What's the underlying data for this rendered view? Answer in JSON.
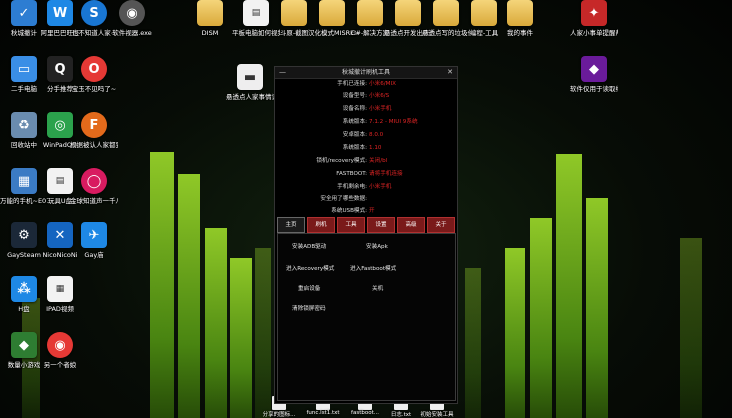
{
  "desktop": {
    "icons": [
      {
        "id": "i1",
        "label": "秋城撤计",
        "color": "#2d7dd2",
        "glyph": "✓"
      },
      {
        "id": "i2",
        "label": "阿里巴巴旺旺",
        "color": "#1e88e5",
        "glyph": "W"
      },
      {
        "id": "i3",
        "label": "也不知道人家~",
        "color": "#1976d2",
        "glyph": "S"
      },
      {
        "id": "i4",
        "label": "软件视器.exe",
        "color": "#555",
        "glyph": "◉"
      },
      {
        "id": "i5",
        "label": "二手电脑",
        "color": "#3a8ee6",
        "glyph": "▭"
      },
      {
        "id": "i6",
        "label": "分手推荐",
        "color": "#222",
        "glyph": "Q"
      },
      {
        "id": "i7",
        "label": "宝玉不见吗了~",
        "color": "#e53935",
        "glyph": "O"
      },
      {
        "id": "i8",
        "label": "回收站中",
        "color": "#6a8caf",
        "glyph": "♻"
      },
      {
        "id": "i9",
        "label": "WinPadQQ",
        "color": "#2ba24c",
        "glyph": "◎"
      },
      {
        "id": "i10",
        "label": "根据被认人家都到哪里",
        "color": "#e36a1b",
        "glyph": "F"
      },
      {
        "id": "i11",
        "label": "万能的手机~E07BA47...",
        "color": "#3b7bc4",
        "glyph": "▦"
      },
      {
        "id": "i12",
        "label": "玩具U盘",
        "color": "#eee",
        "glyph": "▤"
      },
      {
        "id": "i13",
        "label": "金球知道声一千八",
        "color": "#d81b60",
        "glyph": "◯"
      },
      {
        "id": "i14",
        "label": "GaySteam",
        "color": "#1b2838",
        "glyph": "⚙"
      },
      {
        "id": "i15",
        "label": "NicoNicoNi",
        "color": "#1565c0",
        "glyph": "✕"
      },
      {
        "id": "i16",
        "label": "Gay庙",
        "color": "#1e88e5",
        "glyph": "✈"
      },
      {
        "id": "i17",
        "label": "H盘",
        "color": "#1e88e5",
        "glyph": "⁂"
      },
      {
        "id": "i18",
        "label": "IPAD视频",
        "color": "#eee",
        "glyph": "▦"
      },
      {
        "id": "i19",
        "label": "数量小游戏",
        "color": "#2e7d32",
        "glyph": "◆"
      },
      {
        "id": "i20",
        "label": "另一个者娘",
        "color": "#e53935",
        "glyph": "◉"
      },
      {
        "id": "i21",
        "label": "DISM",
        "color": "#f2c94c",
        "glyph": ""
      },
      {
        "id": "i22",
        "label": "平板电脑如何视频到安卓...",
        "color": "#eee",
        "glyph": "▤"
      },
      {
        "id": "i23",
        "label": "斗原-截图",
        "color": "#f2c94c",
        "glyph": ""
      },
      {
        "id": "i24",
        "label": "汉化模式MISREC",
        "color": "#f2c94c",
        "glyph": ""
      },
      {
        "id": "i25",
        "label": "C#-解决方案",
        "color": "#f2c94c",
        "glyph": ""
      },
      {
        "id": "i26",
        "label": "悬透点开发出来的...",
        "color": "#f2c94c",
        "glyph": ""
      },
      {
        "id": "i27",
        "label": "悬透点写的垃圾代码",
        "color": "#f2c94c",
        "glyph": ""
      },
      {
        "id": "i28",
        "label": "编程-工具",
        "color": "#f2c94c",
        "glyph": ""
      },
      {
        "id": "i29",
        "label": "我的事件",
        "color": "#f2c94c",
        "glyph": ""
      },
      {
        "id": "i30",
        "label": "人家小事单提醒帮",
        "color": "#c62828",
        "glyph": "✦"
      },
      {
        "id": "i31",
        "label": "软件仅用于读取结果",
        "color": "#6a1b9a",
        "glyph": "◆"
      },
      {
        "id": "i32",
        "label": "悬透点人家事情记录",
        "color": "#eee",
        "glyph": "▬"
      }
    ],
    "taskbar_files": [
      {
        "label": "分享的图标..."
      },
      {
        "label": "func.lst1.txt"
      },
      {
        "label": "fastboot..."
      },
      {
        "label": "日志.txt"
      },
      {
        "label": "初始安装工具"
      }
    ]
  },
  "tool": {
    "title": "秋城撤计刷机工具",
    "minimize": "—",
    "close": "✕",
    "info": [
      {
        "k": "手机已连接:",
        "v": "小米6/MIX"
      },
      {
        "k": "设备型号:",
        "v": "小米6/S"
      },
      {
        "k": "设备名称:",
        "v": "小米手机"
      },
      {
        "k": "系统版本:",
        "v": "7.1.2 - MIUI 9系统"
      },
      {
        "k": "安卓版本:",
        "v": "8.0.0"
      },
      {
        "k": "系统版本:",
        "v": "1.10"
      },
      {
        "k": "锁机/recovery模式:",
        "v": "关闭/bl"
      },
      {
        "k": "FASTBOOT:",
        "v": "请将手机连接"
      },
      {
        "k": "手机剩余电:",
        "v": "小米手机"
      },
      {
        "k": "安全用了哪些数据:",
        "v": ""
      },
      {
        "k": "系统USB模式:",
        "v": "开"
      }
    ],
    "tabs": [
      "主页",
      "刷机",
      "工具",
      "设置",
      "高级",
      "关于"
    ],
    "actions": {
      "install_adb": "安装ADB驱动",
      "install_apk": "安装Apk",
      "enter_recovery": "进入Recovery模式",
      "enter_fastboot": "进入Fastboot模式",
      "reboot": "重启设备",
      "off": "关机",
      "clear_screen": "清除锁屏密码"
    }
  }
}
